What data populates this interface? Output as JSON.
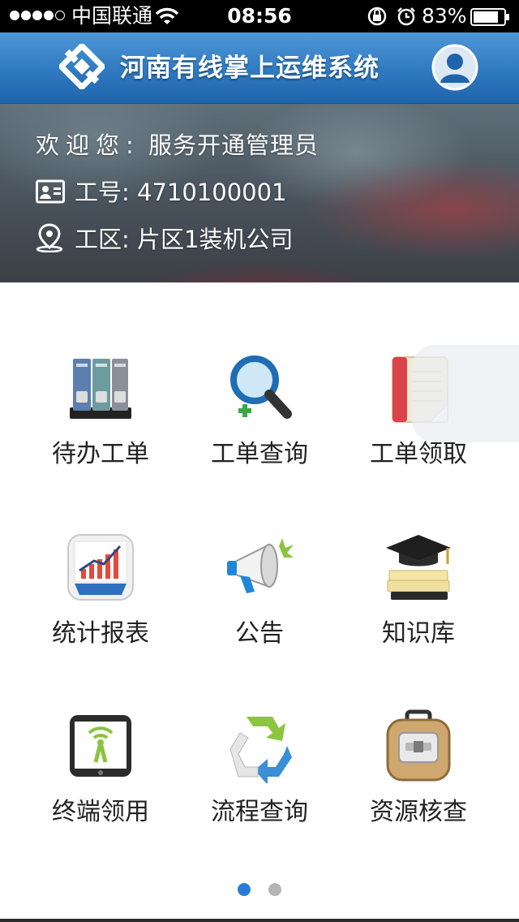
{
  "status_bar": {
    "carrier": "中国联通",
    "time": "08:56",
    "battery_percent": "83%",
    "battery_level": 0.83,
    "signal_bars": 4,
    "signal_max": 5
  },
  "header": {
    "title": "河南有线掌上运维系统",
    "logo_icon": "diamond-logo-icon",
    "avatar_icon": "user-avatar-icon",
    "accent_color": "#2f79c0"
  },
  "user_info": {
    "welcome_label": "欢迎您:",
    "welcome_name": "服务开通管理员",
    "id_label": "工号:",
    "id_value": "4710100001",
    "area_label": "工区:",
    "area_value": "片区1装机公司",
    "id_icon": "id-card-icon",
    "area_icon": "location-pin-icon"
  },
  "menu": {
    "items": [
      {
        "label": "待办工单",
        "icon": "binders-icon"
      },
      {
        "label": "工单查询",
        "icon": "magnifier-icon"
      },
      {
        "label": "工单领取",
        "icon": "worksheet-icon"
      },
      {
        "label": "统计报表",
        "icon": "graph-icon"
      },
      {
        "label": "公告",
        "icon": "megaphone-icon"
      },
      {
        "label": "知识库",
        "icon": "graduation-cap-books-icon"
      },
      {
        "label": "终端领用",
        "icon": "tablet-signal-icon"
      },
      {
        "label": "流程查询",
        "icon": "recycle-arrows-icon"
      },
      {
        "label": "资源核查",
        "icon": "safe-case-icon"
      }
    ]
  },
  "pager": {
    "current_page": 1,
    "total_pages": 2
  }
}
